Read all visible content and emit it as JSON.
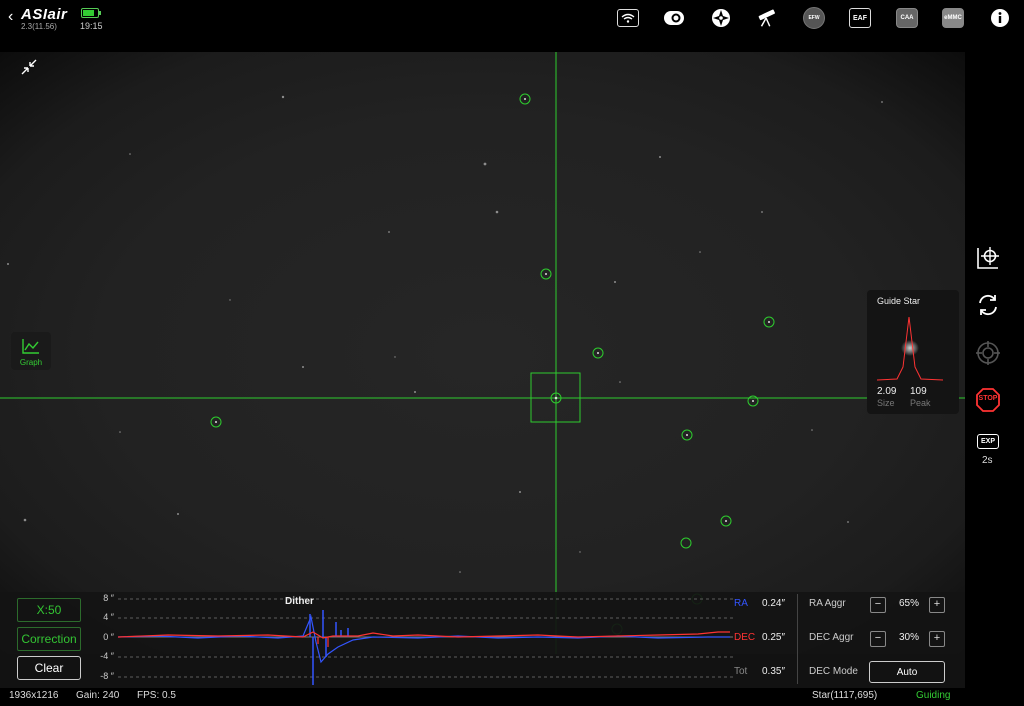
{
  "topbar": {
    "back_icon": "chevron-left",
    "brand": "ASIair",
    "version": "2.3(11.56)",
    "time": "19:15",
    "battery_color": "#33cc33",
    "icons": [
      "wifi-icon",
      "camera-icon",
      "mount-icon",
      "telescope-icon",
      "filter-wheel-icon",
      "focuser-icon",
      "rotator-icon",
      "storage-icon",
      "info-icon"
    ],
    "efw_label": "EFW",
    "eaf_label": "EAF",
    "caa_label": "CAA",
    "emmc_label": "eMMC"
  },
  "guide_star": {
    "title": "Guide Star",
    "size_value": "2.09",
    "size_label": "Size",
    "peak_value": "109",
    "peak_label": "Peak"
  },
  "right_tools": {
    "stop_label": "STOP",
    "exp_label": "EXP",
    "exp_value": "2s"
  },
  "graph_button": {
    "label": "Graph"
  },
  "guide_graph": {
    "scale_button": "X:50",
    "correction_button": "Correction",
    "clear_button": "Clear",
    "event_label": "Dither",
    "y_ticks": [
      "8 ″",
      "4 ″",
      "0 ″",
      "-4 ″",
      "-8 ″"
    ],
    "ra_label": "RA",
    "ra_value": "0.24″",
    "dec_label": "DEC",
    "dec_value": "0.25″",
    "tot_label": "Tot",
    "tot_value": "0.35″",
    "ra_color": "#3355ff",
    "dec_color": "#ff3333"
  },
  "settings": {
    "ra_aggr_label": "RA Aggr",
    "ra_aggr_value": "65%",
    "dec_aggr_label": "DEC Aggr",
    "dec_aggr_value": "30%",
    "dec_mode_label": "DEC Mode",
    "dec_mode_value": "Auto",
    "minus": "−",
    "plus": "+"
  },
  "status": {
    "resolution": "1936x1216",
    "gain": "Gain: 240",
    "fps": "FPS: 0.5",
    "star": "Star(1117,695)",
    "state": "Guiding",
    "state_color": "#33cc33"
  }
}
